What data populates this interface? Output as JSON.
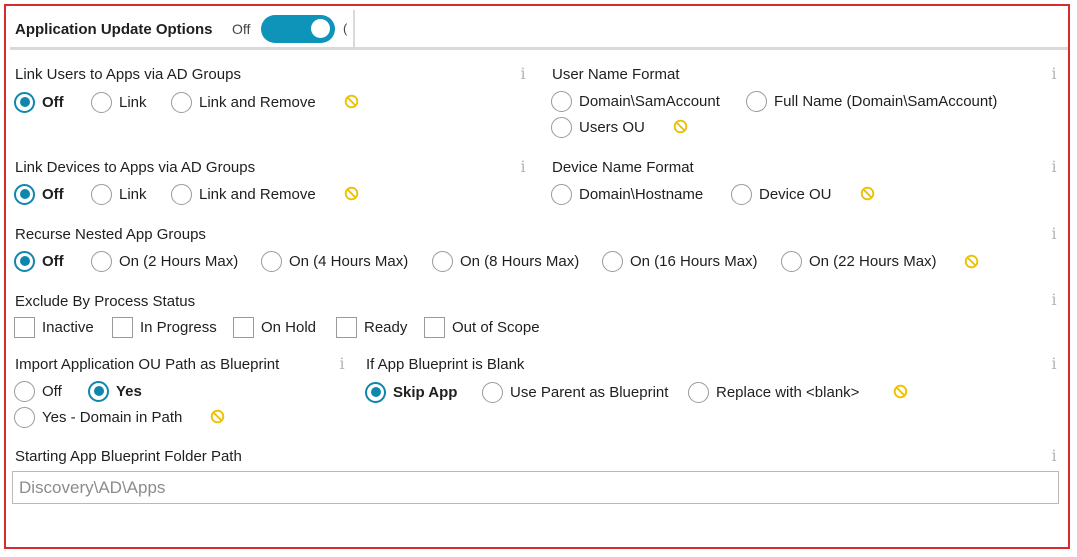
{
  "header": {
    "title": "Application Update Options",
    "toggle_state_label": "Off",
    "toggle_cut_label": "("
  },
  "link_users": {
    "label": "Link Users to Apps via AD Groups",
    "options": [
      "Off",
      "Link",
      "Link and Remove"
    ],
    "selected": "Off"
  },
  "user_name_format": {
    "label": "User Name Format",
    "options": [
      "Domain\\SamAccount",
      "Full Name (Domain\\SamAccount)",
      "Users OU"
    ],
    "selected": null
  },
  "link_devices": {
    "label": "Link Devices to Apps via AD Groups",
    "options": [
      "Off",
      "Link",
      "Link and Remove"
    ],
    "selected": "Off"
  },
  "device_name_format": {
    "label": "Device Name Format",
    "options": [
      "Domain\\Hostname",
      "Device OU"
    ],
    "selected": null
  },
  "recurse_nested": {
    "label": "Recurse Nested App Groups",
    "options": [
      "Off",
      "On (2 Hours Max)",
      "On (4 Hours Max)",
      "On (8 Hours Max)",
      "On (16 Hours Max)",
      "On (22 Hours Max)"
    ],
    "selected": "Off"
  },
  "exclude_status": {
    "label": "Exclude By Process Status",
    "options": [
      "Inactive",
      "In Progress",
      "On Hold",
      "Ready",
      "Out of Scope"
    ],
    "checked": []
  },
  "import_ou": {
    "label": "Import Application OU Path as Blueprint",
    "options": [
      "Off",
      "Yes",
      "Yes - Domain in Path"
    ],
    "selected": "Yes"
  },
  "blank_blueprint": {
    "label": "If App Blueprint is Blank",
    "options": [
      "Skip App",
      "Use Parent as Blueprint",
      "Replace with <blank>"
    ],
    "selected": "Skip App"
  },
  "starting_path": {
    "label": "Starting App Blueprint Folder Path",
    "placeholder": "Discovery\\AD\\Apps"
  },
  "icons": {
    "info": "i",
    "ban_color": "#f0c000",
    "accent": "#0e87ab"
  }
}
